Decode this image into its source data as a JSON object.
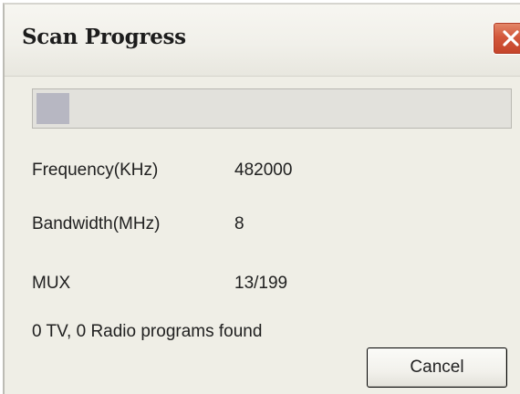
{
  "window": {
    "title": "Scan Progress"
  },
  "titlebar": {
    "close_icon": "close-icon",
    "close_color": "#d3583c"
  },
  "progress": {
    "fraction": 0.07
  },
  "fields": [
    {
      "label": "Frequency(KHz)",
      "value": "482000"
    },
    {
      "label": "Bandwidth(MHz)",
      "value": "8"
    },
    {
      "label": "MUX",
      "value": "13/199"
    }
  ],
  "status": "0 TV, 0 Radio programs found",
  "buttons": {
    "cancel_label": "Cancel"
  }
}
